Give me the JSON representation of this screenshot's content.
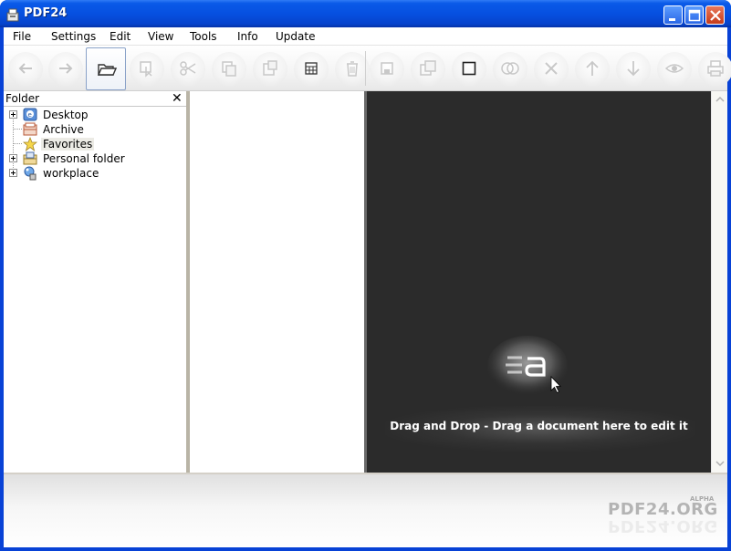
{
  "window": {
    "title": "PDF24",
    "controls": [
      "minimize-icon",
      "maximize-icon",
      "close-icon"
    ]
  },
  "menu": {
    "items": [
      "File",
      "Settings",
      "Edit",
      "View",
      "Tools",
      "Info",
      "Update"
    ]
  },
  "toolbar": {
    "tools": [
      {
        "name": "back-icon"
      },
      {
        "name": "forward-icon"
      },
      {
        "name": "open-folder-icon",
        "active": true
      },
      {
        "name": "select-icon"
      },
      {
        "name": "cut-icon"
      },
      {
        "name": "copy-icon"
      },
      {
        "name": "paste-icon"
      },
      {
        "name": "grid-icon"
      },
      {
        "name": "delete-icon"
      },
      {
        "name": "save-icon"
      },
      {
        "name": "save-as-icon"
      },
      {
        "name": "square-icon"
      },
      {
        "name": "merge-icon"
      },
      {
        "name": "remove-icon"
      },
      {
        "name": "move-up-icon"
      },
      {
        "name": "move-down-icon"
      },
      {
        "name": "preview-icon"
      },
      {
        "name": "print-icon"
      }
    ]
  },
  "folder_panel": {
    "title": "Folder",
    "close": "✕",
    "items": [
      {
        "label": "Desktop",
        "icon": "desktop-icon",
        "expandable": true
      },
      {
        "label": "Archive",
        "icon": "archive-icon",
        "expandable": false
      },
      {
        "label": "Favorites",
        "icon": "favorites-star-icon",
        "expandable": false,
        "selected": true
      },
      {
        "label": "Personal folder",
        "icon": "personal-folder-icon",
        "expandable": true
      },
      {
        "label": "workplace",
        "icon": "workplace-icon",
        "expandable": true
      }
    ]
  },
  "drop_area": {
    "text": "Drag and Drop - Drag a document here to edit it"
  },
  "branding": {
    "tag": "ALPHA",
    "name": "PDF24.ORG"
  },
  "colors": {
    "titlebar": "#0650e0",
    "drop_bg": "#2b2b2b"
  }
}
